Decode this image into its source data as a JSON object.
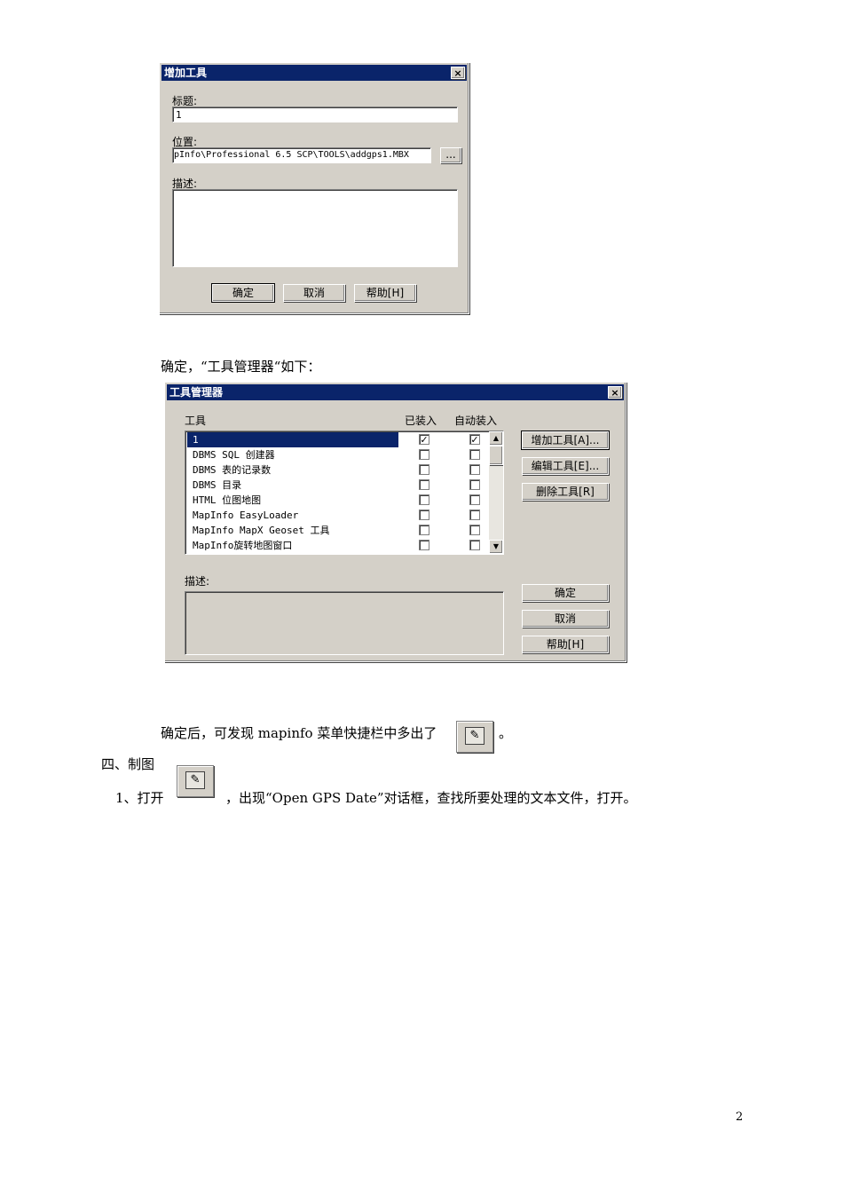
{
  "dialog_add_tool": {
    "title": "增加工具",
    "close_label": "×",
    "caption_label": "标题:",
    "caption_value": "1",
    "location_label": "位置:",
    "location_value": "pInfo\\Professional 6.5 SCP\\TOOLS\\addgps1.MBX",
    "browse_label": "...",
    "description_label": "描述:",
    "description_value": "",
    "buttons": {
      "ok": "确定",
      "cancel": "取消",
      "help": "帮助[H]"
    }
  },
  "text_after_first_dialog": "确定，“工具管理器“如下：",
  "dialog_tool_manager": {
    "title": "工具管理器",
    "close_label": "×",
    "col_tool": "工具",
    "col_loaded": "已装入",
    "col_autoload": "自动装入",
    "tools": [
      {
        "name": "1",
        "loaded": true,
        "autoload": true
      },
      {
        "name": "DBMS SQL 创建器",
        "loaded": false,
        "autoload": false
      },
      {
        "name": "DBMS 表的记录数",
        "loaded": false,
        "autoload": false
      },
      {
        "name": "DBMS 目录",
        "loaded": false,
        "autoload": false
      },
      {
        "name": "HTML 位图地图",
        "loaded": false,
        "autoload": false
      },
      {
        "name": "MapInfo EasyLoader",
        "loaded": false,
        "autoload": false
      },
      {
        "name": "MapInfo MapX Geoset 工具",
        "loaded": false,
        "autoload": false
      },
      {
        "name": "MapInfo旋转地图窗口",
        "loaded": false,
        "autoload": false
      }
    ],
    "check_mark": "✓",
    "buttons": {
      "add": "增加工具[A]...",
      "edit": "编辑工具[E]...",
      "delete": "删除工具[R]",
      "ok": "确定",
      "cancel": "取消",
      "help": "帮助[H]"
    },
    "description_label": "描述:",
    "scroll_up": "▲",
    "scroll_down": "▼"
  },
  "text_after_second_dialog_before": "确定后，可发现 mapinfo 菜单快捷栏中多出了",
  "text_after_second_dialog_after": "。",
  "section_heading": "四、制图",
  "step1_before": "1、打开",
  "step1_after": "，出现“Open GPS Date”对话框，查找所要处理的文本文件，打开。",
  "tool_icon_name": "gps-pencil-icon",
  "page_number": "2"
}
